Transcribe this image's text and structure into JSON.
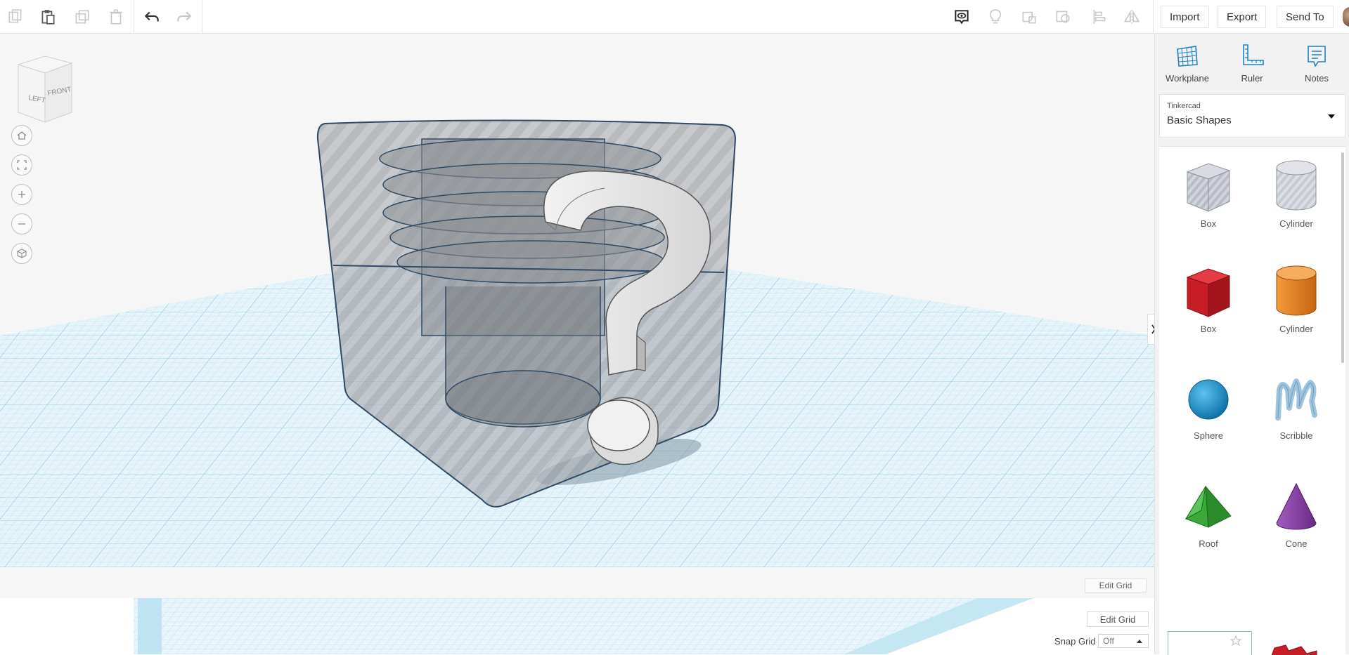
{
  "toolbar": {
    "import_label": "Import",
    "export_label": "Export",
    "send_to_label": "Send To"
  },
  "viewcube": {
    "left_label": "LEFT",
    "front_label": "FRONT"
  },
  "viewport": {
    "edit_grid_label": "Edit Grid",
    "edit_grid_label_2": "Edit Grid",
    "snap_grid_label": "Snap Grid",
    "snap_grid_value": "Off"
  },
  "panel": {
    "tools": [
      {
        "label": "Workplane",
        "icon": "workplane-icon"
      },
      {
        "label": "Ruler",
        "icon": "ruler-icon"
      },
      {
        "label": "Notes",
        "icon": "notes-icon"
      }
    ],
    "library_category": "Tinkercad",
    "library_name": "Basic Shapes",
    "shapes": [
      {
        "label": "Box",
        "color": "#b8bcc7"
      },
      {
        "label": "Cylinder",
        "color": "#c6cad3"
      },
      {
        "label": "Box",
        "color": "#d4202b"
      },
      {
        "label": "Cylinder",
        "color": "#e67e1e"
      },
      {
        "label": "Sphere",
        "color": "#1a9ad9"
      },
      {
        "label": "Scribble",
        "color": "#9ec4dd"
      },
      {
        "label": "Roof",
        "color": "#3aa83a"
      },
      {
        "label": "Cone",
        "color": "#8a3fa6"
      }
    ]
  },
  "colors": {
    "grid_blue": "#a9d8ea",
    "accent_blue": "#1b82c4"
  }
}
